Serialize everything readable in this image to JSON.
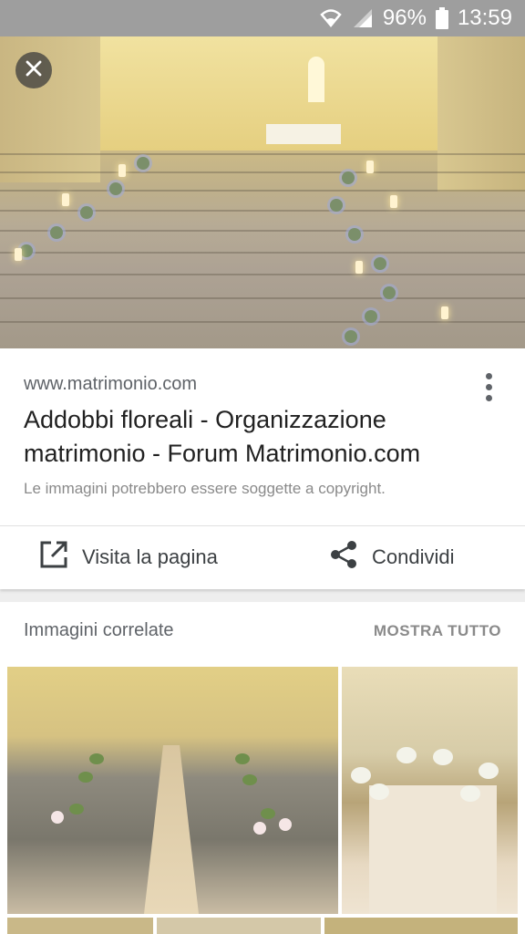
{
  "status_bar": {
    "battery_percent": "96%",
    "time": "13:59"
  },
  "image_viewer": {
    "source_domain": "www.matrimonio.com",
    "title": "Addobbi floreali - Organizzazione matrimonio - Forum Matrimonio.com",
    "copyright_notice": "Le immagini potrebbero essere soggette a copyright.",
    "actions": {
      "visit_label": "Visita la pagina",
      "share_label": "Condividi"
    }
  },
  "related": {
    "heading": "Immagini correlate",
    "show_all_label": "MOSTRA TUTTO"
  },
  "icons": {
    "close": "close-icon",
    "more": "more-vert-icon",
    "open_external": "open-in-new-icon",
    "share": "share-icon",
    "wifi": "wifi-icon",
    "signal": "signal-icon",
    "battery": "battery-icon"
  }
}
